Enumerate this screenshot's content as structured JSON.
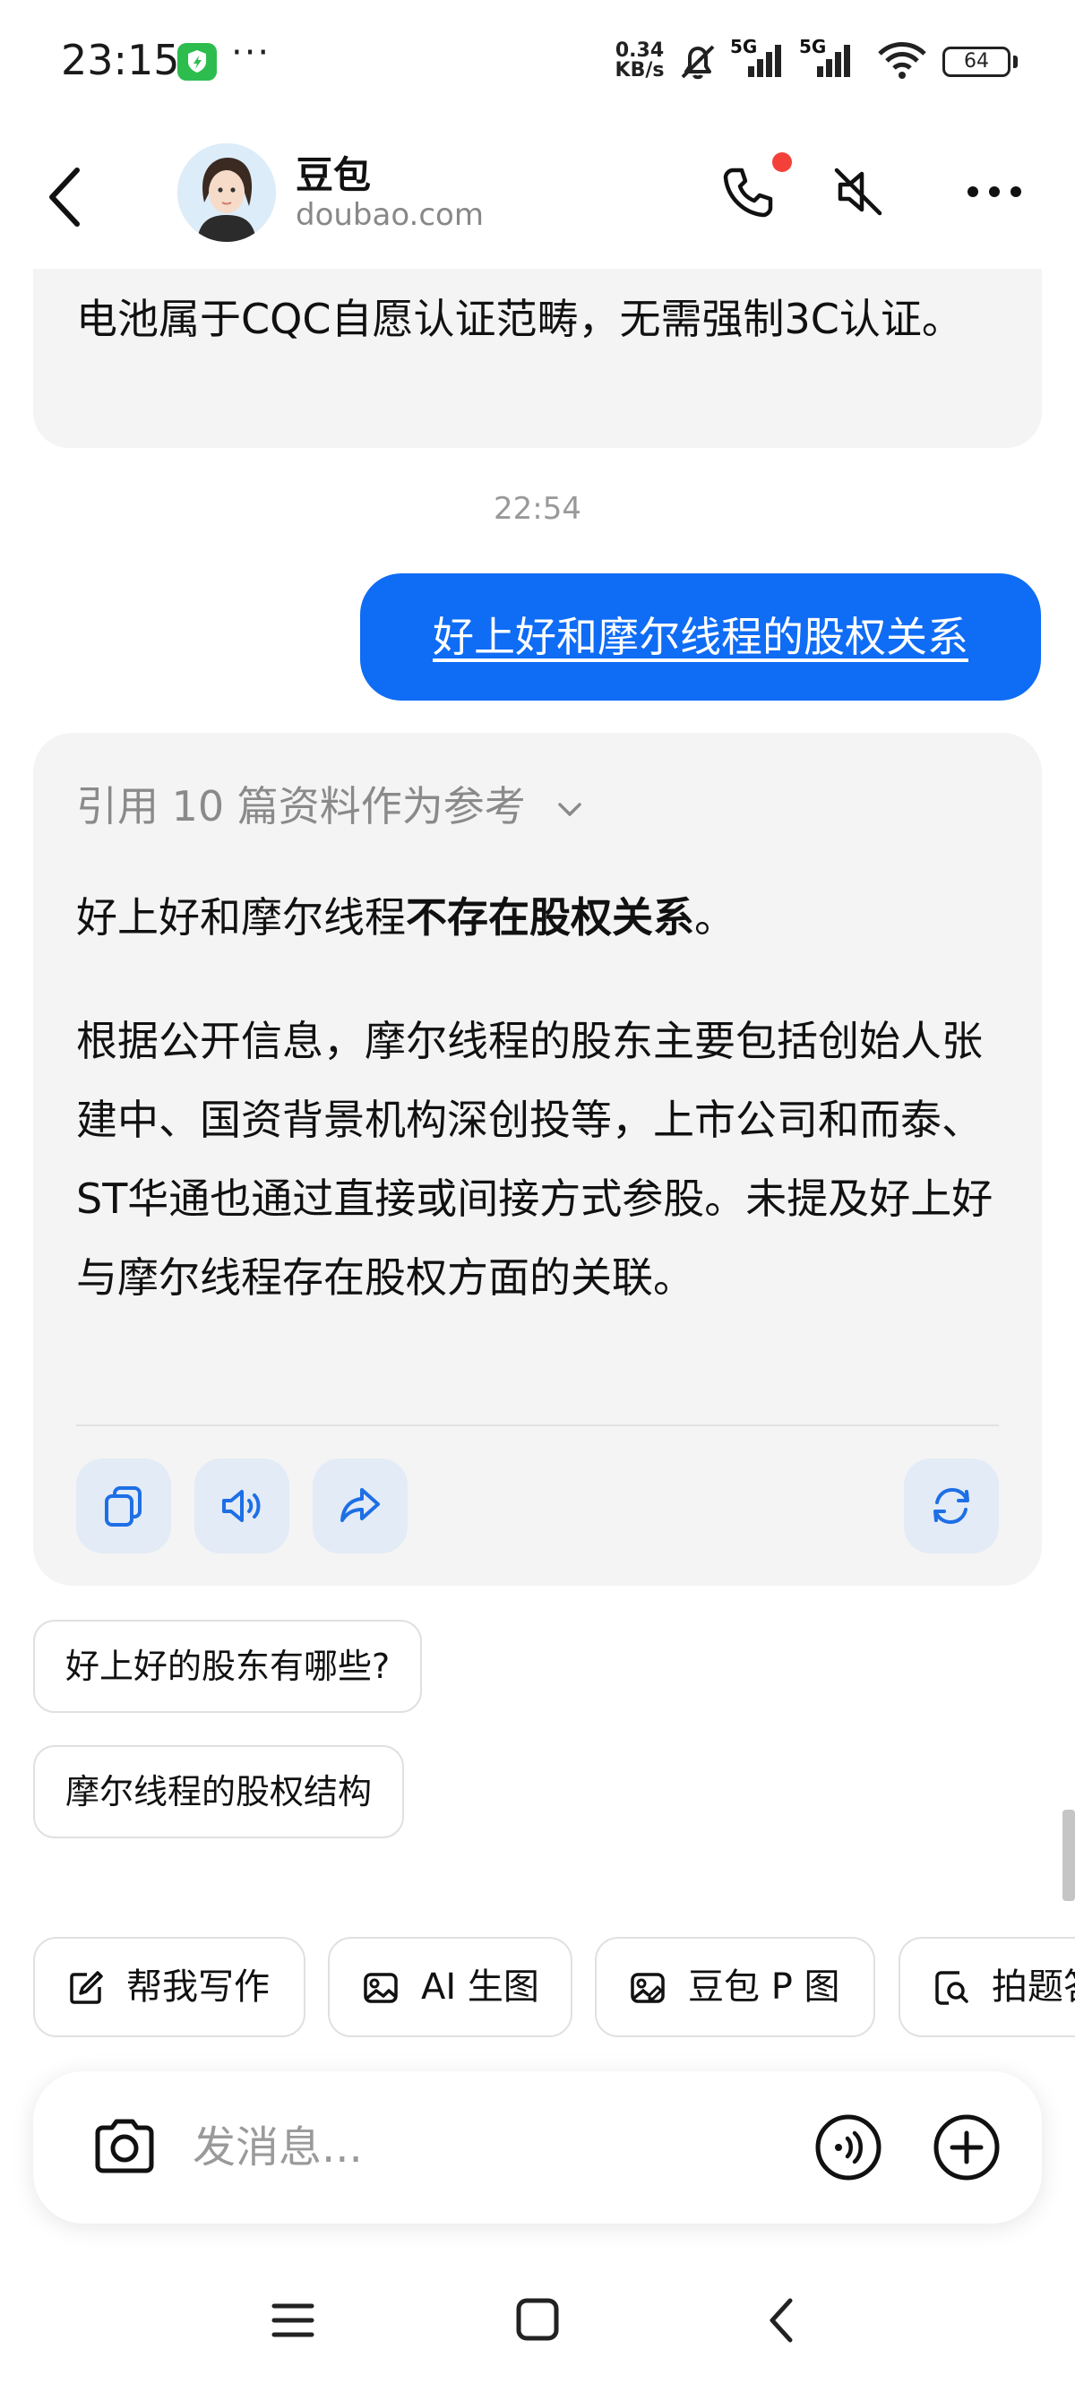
{
  "status_bar": {
    "time": "23:15",
    "dots": "···",
    "speed_value": "0.34",
    "speed_unit": "KB/s",
    "network_1": "5G",
    "network_2": "5G",
    "battery": "64"
  },
  "header": {
    "title": "豆包",
    "subtitle": "doubao.com"
  },
  "chat": {
    "previous_text": "电池属于CQC自愿认证范畴，无需强制3C认证。",
    "timestamp": "22:54",
    "user_message": "好上好和摩尔线程的股权关系",
    "reference_label": "引用 10 篇资料作为参考",
    "summary_prefix": "好上好和摩尔线程",
    "summary_bold": "不存在股权关系",
    "summary_suffix": "。",
    "body": "根据公开信息，摩尔线程的股东主要包括创始人张建中、国资背景机构深创投等，上市公司和而泰、ST华通也通过直接或间接方式参股。未提及好上好与摩尔线程存在股权方面的关联。"
  },
  "suggestions": [
    "好上好的股东有哪些?",
    "摩尔线程的股权结构"
  ],
  "toolbar_chips": [
    "帮我写作",
    "AI 生图",
    "豆包 P 图",
    "拍题答疑"
  ],
  "input": {
    "placeholder": "发消息..."
  },
  "colors": {
    "accent": "#0f6cf5",
    "bubble_bg": "#f4f4f4",
    "action_btn_bg": "#e3ebf6",
    "call_badge": "#f3413a"
  }
}
